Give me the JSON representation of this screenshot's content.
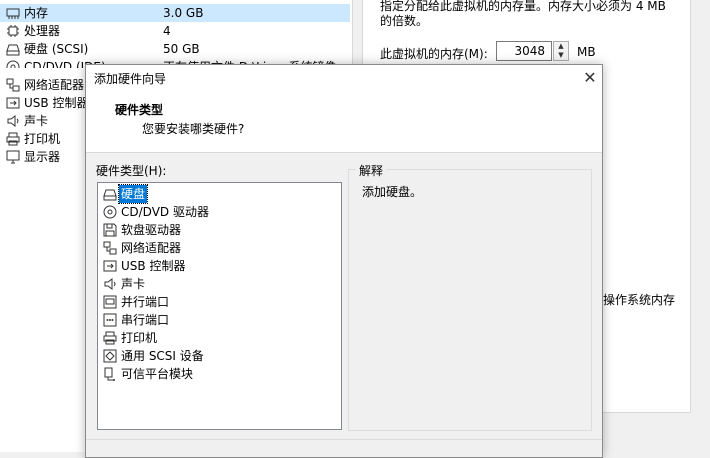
{
  "background": {
    "devices": [
      {
        "name": "内存",
        "summary": "3.0 GB",
        "icon": "memory-icon",
        "selected": true
      },
      {
        "name": "处理器",
        "summary": "4",
        "icon": "cpu-icon"
      },
      {
        "name": "硬盘 (SCSI)",
        "summary": "50 GB",
        "icon": "harddisk-icon"
      },
      {
        "name": "CD/DVD (IDE)",
        "summary": "正在使用文件 D:\\Linux系统镜像...",
        "icon": "cdrom-icon"
      },
      {
        "name": "网络适配器",
        "summary": "",
        "icon": "network-icon"
      },
      {
        "name": "USB 控制器",
        "summary": "",
        "icon": "usb-icon"
      },
      {
        "name": "声卡",
        "summary": "",
        "icon": "sound-icon"
      },
      {
        "name": "打印机",
        "summary": "",
        "icon": "printer-icon"
      },
      {
        "name": "显示器",
        "summary": "",
        "icon": "monitor-icon"
      }
    ],
    "memory_desc_line1": "指定分配给此虚拟机的内存量。内存大小必须为 4 MB",
    "memory_desc_line2": "的倍数。",
    "memory_label": "此虚拟机的内存(M):",
    "memory_value": "3048",
    "memory_unit": "MB",
    "partial_text": "操作系统内存"
  },
  "dialog": {
    "title": "添加硬件向导",
    "heading": "硬件类型",
    "subheading": "您要安装哪类硬件?",
    "list_label": "硬件类型(H):",
    "items": [
      {
        "label": "硬盘",
        "icon": "harddisk-icon",
        "selected": true
      },
      {
        "label": "CD/DVD 驱动器",
        "icon": "cdrom-icon"
      },
      {
        "label": "软盘驱动器",
        "icon": "floppy-icon"
      },
      {
        "label": "网络适配器",
        "icon": "network-icon"
      },
      {
        "label": "USB 控制器",
        "icon": "usb-icon"
      },
      {
        "label": "声卡",
        "icon": "sound-icon"
      },
      {
        "label": "并行端口",
        "icon": "parallel-port-icon"
      },
      {
        "label": "串行端口",
        "icon": "serial-port-icon"
      },
      {
        "label": "打印机",
        "icon": "printer-icon"
      },
      {
        "label": "通用 SCSI 设备",
        "icon": "scsi-icon"
      },
      {
        "label": "可信平台模块",
        "icon": "tpm-icon"
      }
    ],
    "explanation_label": "解释",
    "explanation_text": "添加硬盘。"
  },
  "colors": {
    "selection": "#0078d7",
    "row_highlight": "#cce8ff"
  }
}
